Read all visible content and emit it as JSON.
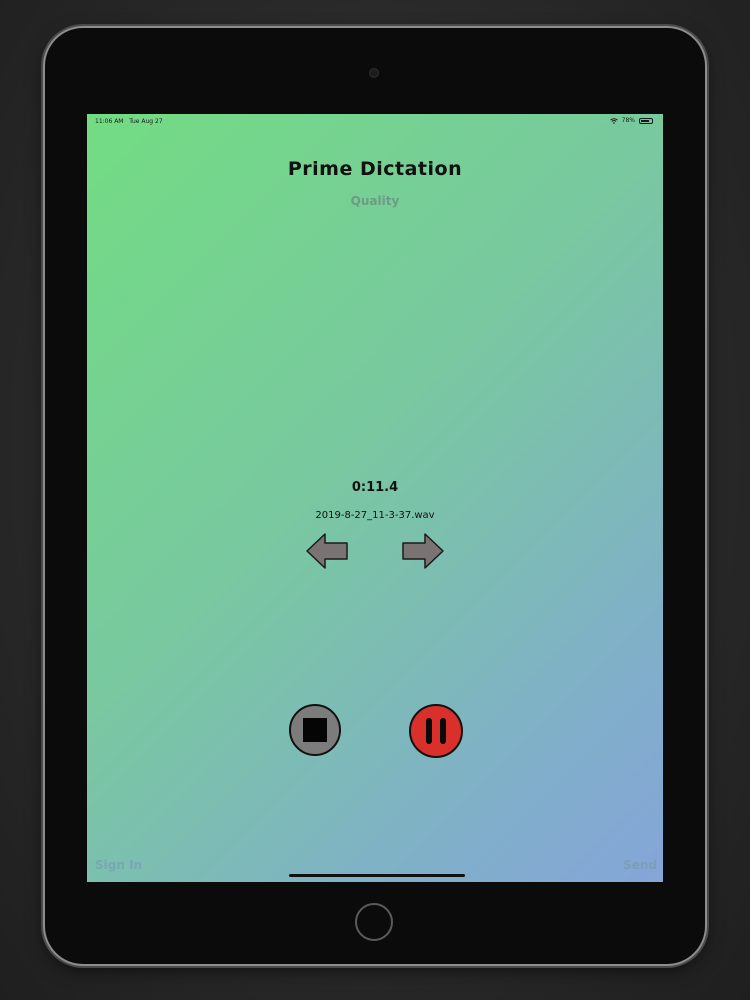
{
  "status_bar": {
    "time": "11:06 AM",
    "date": "Tue Aug 27",
    "battery_percent": "78%",
    "battery_level": 0.78
  },
  "header": {
    "title": "Prime Dictation",
    "quality_label": "Quality"
  },
  "recording": {
    "elapsed_time": "0:11.4",
    "filename": "2019-8-27_11-3-37.wav"
  },
  "footer": {
    "sign_in_label": "Sign In",
    "send_label": "Send"
  },
  "colors": {
    "gradient_start": "#72dc82",
    "gradient_end": "#85a5d8",
    "pause_button": "#d9302c",
    "stop_button": "#7c7c7c",
    "arrow_fill": "#7b7373"
  },
  "icons": {
    "wifi": "wifi-icon",
    "battery": "battery-icon",
    "previous": "arrow-left-icon",
    "next": "arrow-right-icon",
    "stop": "stop-icon",
    "pause": "pause-icon"
  }
}
